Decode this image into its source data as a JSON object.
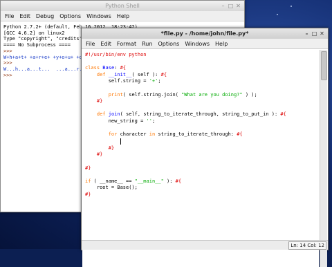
{
  "shell": {
    "title": "Python Shell",
    "menu": [
      "File",
      "Edit",
      "Debug",
      "Options",
      "Windows",
      "Help"
    ],
    "lines": [
      {
        "text": "Python 2.7.2+ (default, Feb 16 2012, 18:23:42)",
        "cls": ""
      },
      {
        "text": "[GCC 4.6.2] on linux2",
        "cls": ""
      },
      {
        "text": "Type \"copyright\", \"credits\"",
        "cls": ""
      },
      {
        "text": "==== No Subprocess ====",
        "cls": ""
      },
      {
        "text": ">>> ",
        "cls": "prompt"
      },
      {
        "text": "W+h+a+t+ +a+r+e+ +y+o+u+ +d",
        "cls": "out"
      },
      {
        "text": ">>> ",
        "cls": "prompt"
      },
      {
        "text": "W...h...a...t...  ...a...r...",
        "cls": "out"
      },
      {
        "text": ">>> ",
        "cls": "prompt"
      }
    ]
  },
  "editor": {
    "title": "*file.py - /home/john/file.py*",
    "menu": [
      "File",
      "Edit",
      "Format",
      "Run",
      "Options",
      "Windows",
      "Help"
    ],
    "code": [
      [
        [
          "#!/usr/bin/env python",
          "cm"
        ]
      ],
      [
        [
          "",
          ""
        ]
      ],
      [
        [
          "class",
          "kw"
        ],
        [
          " ",
          ""
        ],
        [
          "Base",
          "df"
        ],
        [
          ": ",
          ""
        ],
        [
          "#{",
          "cm"
        ]
      ],
      [
        [
          "    ",
          ""
        ],
        [
          "def",
          "kw"
        ],
        [
          " ",
          ""
        ],
        [
          "__init__",
          "df"
        ],
        [
          "( self ): ",
          ""
        ],
        [
          "#{",
          "cm"
        ]
      ],
      [
        [
          "        self.string = ",
          ""
        ],
        [
          "'+'",
          "st"
        ],
        [
          ";",
          ""
        ]
      ],
      [
        [
          "",
          ""
        ]
      ],
      [
        [
          "        ",
          ""
        ],
        [
          "print",
          "kw"
        ],
        [
          "( self.string.join( ",
          ""
        ],
        [
          "\"What are you doing?\"",
          "st"
        ],
        [
          " ) );",
          ""
        ]
      ],
      [
        [
          "    ",
          ""
        ],
        [
          "#}",
          "cm"
        ]
      ],
      [
        [
          "",
          ""
        ]
      ],
      [
        [
          "    ",
          ""
        ],
        [
          "def",
          "kw"
        ],
        [
          " ",
          ""
        ],
        [
          "join",
          "df"
        ],
        [
          "( self, string_to_iterate_through, string_to_put_in ): ",
          ""
        ],
        [
          "#{",
          "cm"
        ]
      ],
      [
        [
          "        new_string = ",
          ""
        ],
        [
          "''",
          "st"
        ],
        [
          ";",
          ""
        ]
      ],
      [
        [
          "",
          ""
        ]
      ],
      [
        [
          "        ",
          ""
        ],
        [
          "for",
          "kw"
        ],
        [
          " character ",
          ""
        ],
        [
          "in",
          "kw"
        ],
        [
          " string_to_iterate_through: ",
          ""
        ],
        [
          "#{",
          "cm"
        ]
      ],
      [
        [
          "            ",
          ""
        ],
        [
          "|caret|",
          "caret"
        ]
      ],
      [
        [
          "        ",
          ""
        ],
        [
          "#}",
          "cm"
        ]
      ],
      [
        [
          "    ",
          ""
        ],
        [
          "#}",
          "cm"
        ]
      ],
      [
        [
          "",
          ""
        ]
      ],
      [
        [
          "#}",
          "cm"
        ]
      ],
      [
        [
          "",
          ""
        ]
      ],
      [
        [
          "if",
          "kw"
        ],
        [
          " ( __name__ == ",
          ""
        ],
        [
          "\"__main__\"",
          "st"
        ],
        [
          " ): ",
          ""
        ],
        [
          "#{",
          "cm"
        ]
      ],
      [
        [
          "    root = Base();",
          ""
        ]
      ],
      [
        [
          "#}",
          "cm"
        ]
      ]
    ]
  },
  "status": {
    "position": "Ln: 14 Col: 12"
  }
}
